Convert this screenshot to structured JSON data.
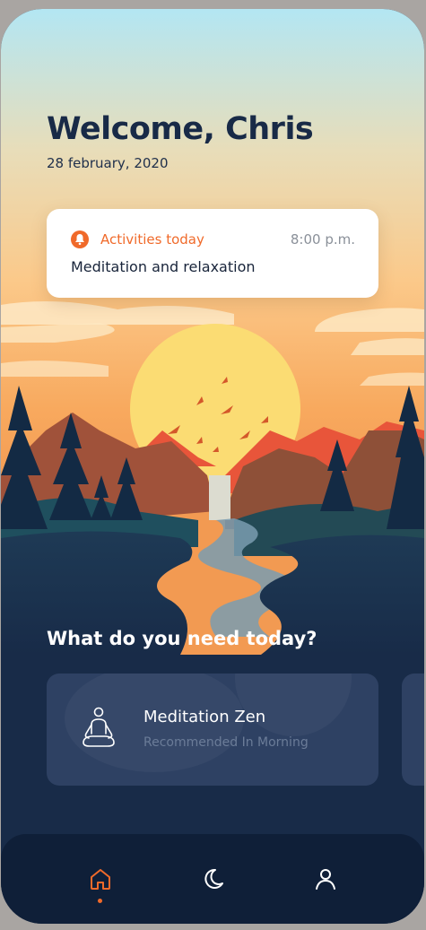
{
  "header": {
    "greeting": "Welcome, Chris",
    "date": "28 february, 2020"
  },
  "activity": {
    "label": "Activities today",
    "time": "8:00 p.m.",
    "text": "Meditation and relaxation",
    "icon": "bell-icon"
  },
  "section": {
    "title": "What do you need today?"
  },
  "recommendations": [
    {
      "title": "Meditation Zen",
      "subtitle": "Recommended In Morning",
      "icon": "meditation-icon"
    }
  ],
  "tabbar": {
    "items": [
      {
        "icon": "home-icon",
        "active": true
      },
      {
        "icon": "moon-icon",
        "active": false
      },
      {
        "icon": "profile-icon",
        "active": false
      }
    ]
  },
  "colors": {
    "accent": "#f06a2a",
    "navy": "#182b48",
    "card": "#2e4163",
    "tabbar": "#0f1f38"
  }
}
